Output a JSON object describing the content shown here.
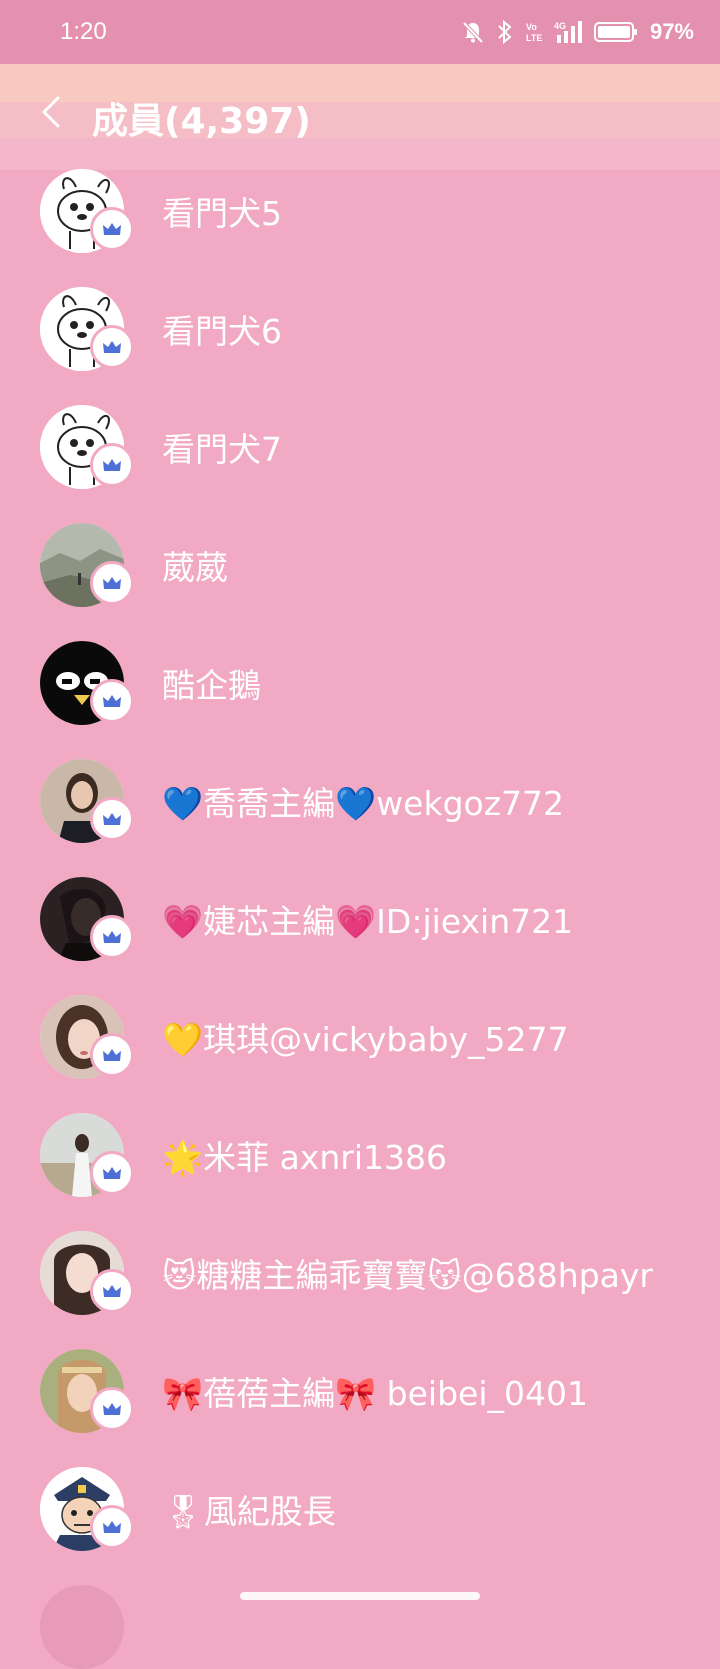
{
  "status_bar": {
    "time": "1:20",
    "battery": "97%",
    "icons": [
      "mute-bell-icon",
      "bluetooth-icon",
      "volte-icon",
      "signal-4g-icon",
      "battery-icon"
    ]
  },
  "header": {
    "title": "成員(4,397)",
    "back_icon": "chevron-left-icon"
  },
  "members": [
    {
      "name": "看門犬5",
      "avatar": "dog-avatar"
    },
    {
      "name": "看門犬6",
      "avatar": "dog-avatar"
    },
    {
      "name": "看門犬7",
      "avatar": "dog-avatar"
    },
    {
      "name": "葳葳",
      "avatar": "landscape-avatar"
    },
    {
      "name": "酷企鵝",
      "avatar": "penguin-avatar"
    },
    {
      "name": "💙喬喬主編💙wekgoz772",
      "avatar": "photo-avatar"
    },
    {
      "name": "💗婕芯主編💗ID:jiexin721",
      "avatar": "photo-avatar"
    },
    {
      "name": "💛琪琪@vickybaby_5277",
      "avatar": "photo-avatar"
    },
    {
      "name": "🌟米菲 axnri1386",
      "avatar": "photo-avatar"
    },
    {
      "name": "😻糖糖主編乖寶寶😽@688hpayr",
      "avatar": "photo-avatar"
    },
    {
      "name": "🎀蓓蓓主編🎀 beibei_0401",
      "avatar": "photo-avatar"
    },
    {
      "name": "🎖風紀股長",
      "avatar": "police-avatar"
    }
  ],
  "colors": {
    "background": "#f1a9c4",
    "status_bar": "#e491b0",
    "crown": "#4e6fd6"
  }
}
